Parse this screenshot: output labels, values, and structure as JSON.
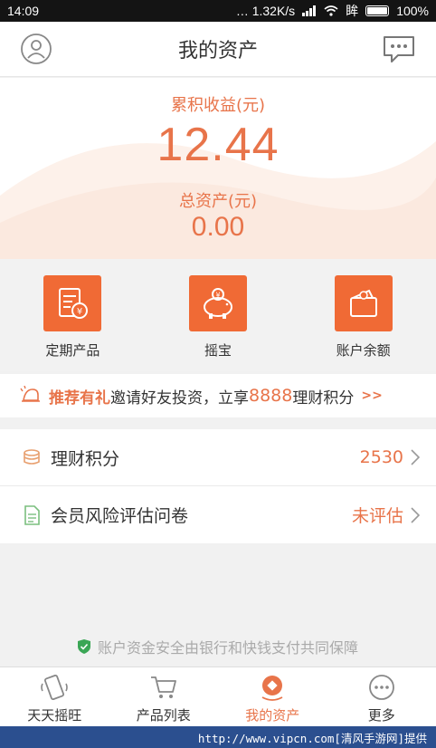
{
  "status_bar": {
    "time": "14:09",
    "net_speed": "… 1.32K/s",
    "carrier": "眸",
    "battery": "100%"
  },
  "header": {
    "title": "我的资产",
    "avatar_icon": "user-icon",
    "message_icon": "chat-bubble-icon"
  },
  "summary": {
    "earnings_label": "累积收益(元)",
    "earnings_value": "12.44",
    "assets_label": "总资产(元)",
    "assets_value": "0.00"
  },
  "shortcuts": [
    {
      "label": "定期产品",
      "icon": "document-yuan-icon"
    },
    {
      "label": "摇宝",
      "icon": "piggy-bank-icon"
    },
    {
      "label": "账户余额",
      "icon": "wallet-icon"
    }
  ],
  "promo": {
    "icon": "bell-icon",
    "title": "推荐有礼",
    "text1": "邀请好友投资，立享",
    "points": "8888",
    "text2": "理财积分",
    "arrow": ">>"
  },
  "list": [
    {
      "label": "理财积分",
      "value": "2530",
      "icon": "coins-icon"
    },
    {
      "label": "会员风险评估问卷",
      "value": "未评估",
      "icon": "document-icon"
    }
  ],
  "security_note": "账户资金安全由银行和快钱支付共同保障",
  "tabs": [
    {
      "label": "天天摇旺",
      "icon": "shake-phone-icon",
      "active": false
    },
    {
      "label": "产品列表",
      "icon": "cart-icon",
      "active": false
    },
    {
      "label": "我的资产",
      "icon": "assets-icon",
      "active": true
    },
    {
      "label": "更多",
      "icon": "more-icon",
      "active": false
    }
  ],
  "watermark": "http://www.vipcn.com[清风手游网]提供",
  "colors": {
    "accent": "#e8744a",
    "tile": "#f06a35",
    "status_bar": "#141414",
    "watermark_bg": "#2b4f8f"
  }
}
